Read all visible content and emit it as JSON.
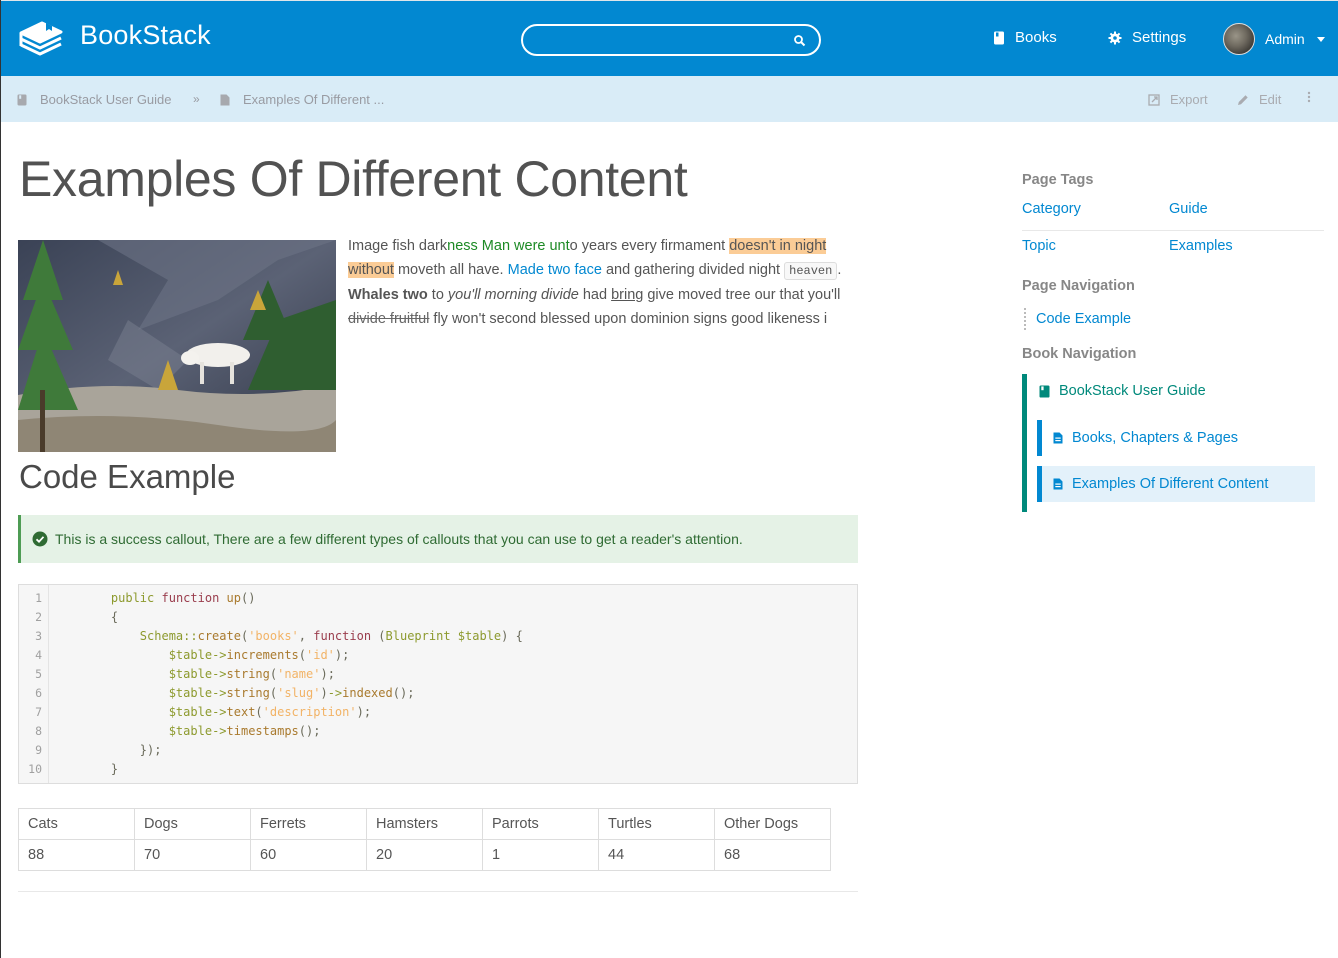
{
  "header": {
    "brand": "BookStack",
    "search_placeholder": "",
    "nav": {
      "books": "Books",
      "settings": "Settings"
    },
    "user": {
      "name": "Admin"
    }
  },
  "breadcrumb": {
    "items": [
      {
        "label": "BookStack User Guide",
        "icon": "book-icon"
      },
      {
        "label": "Examples Of Different ...",
        "icon": "page-icon"
      }
    ],
    "separator": "»"
  },
  "actions": {
    "export": "Export",
    "edit": "Edit"
  },
  "page": {
    "title": "Examples Of Different Content",
    "paragraph": {
      "t1": "Image fish dark",
      "green": "ness Man were unt",
      "t2": "o years every firmament ",
      "highlight1": "doesn't in night",
      "highlight2": "without",
      "t3": " moveth all have. ",
      "link": "Made two face",
      "t4": " and gathering divided night ",
      "code": "heaven",
      "t5": ".",
      "bold": "Whales two",
      "t6": " to ",
      "italic": "you'll morning divide",
      "t7": " had ",
      "underline": "bring",
      "t8": " give moved tree our that you'll ",
      "strike": "divide fruitful",
      "t9": " fly won't second blessed upon dominion signs good likeness i"
    },
    "heading2": "Code Example",
    "callout": "This is a success callout, There are a few different types of callouts that you can use to get a reader's attention.",
    "code": {
      "line_numbers": [
        "1",
        "2",
        "3",
        "4",
        "5",
        "6",
        "7",
        "8",
        "9",
        "10"
      ],
      "lines": [
        "    public function up()",
        "    {",
        "        Schema::create('books', function (Blueprint $table) {",
        "            $table->increments('id');",
        "            $table->string('name');",
        "            $table->string('slug')->indexed();",
        "            $table->text('description');",
        "            $table->timestamps();",
        "        });",
        "    }"
      ]
    },
    "table": {
      "headers": [
        "Cats",
        "Dogs",
        "Ferrets",
        "Hamsters",
        "Parrots",
        "Turtles",
        "Other Dogs"
      ],
      "values": [
        "88",
        "70",
        "60",
        "20",
        "1",
        "44",
        "68"
      ]
    }
  },
  "sidebar": {
    "tags_heading": "Page Tags",
    "tags": [
      {
        "name": "Category",
        "value": "Guide"
      },
      {
        "name": "Topic",
        "value": "Examples"
      }
    ],
    "page_nav_heading": "Page Navigation",
    "page_nav": [
      "Code Example"
    ],
    "book_nav_heading": "Book Navigation",
    "book": "BookStack User Guide",
    "pages": [
      "Books, Chapters & Pages",
      "Examples Of Different Content"
    ]
  },
  "colors": {
    "primary": "#0288D1",
    "subbar": "#D9ECF7",
    "book_accent": "#00897b",
    "success": "#4e9c54",
    "highlight": "#fbcc96"
  }
}
